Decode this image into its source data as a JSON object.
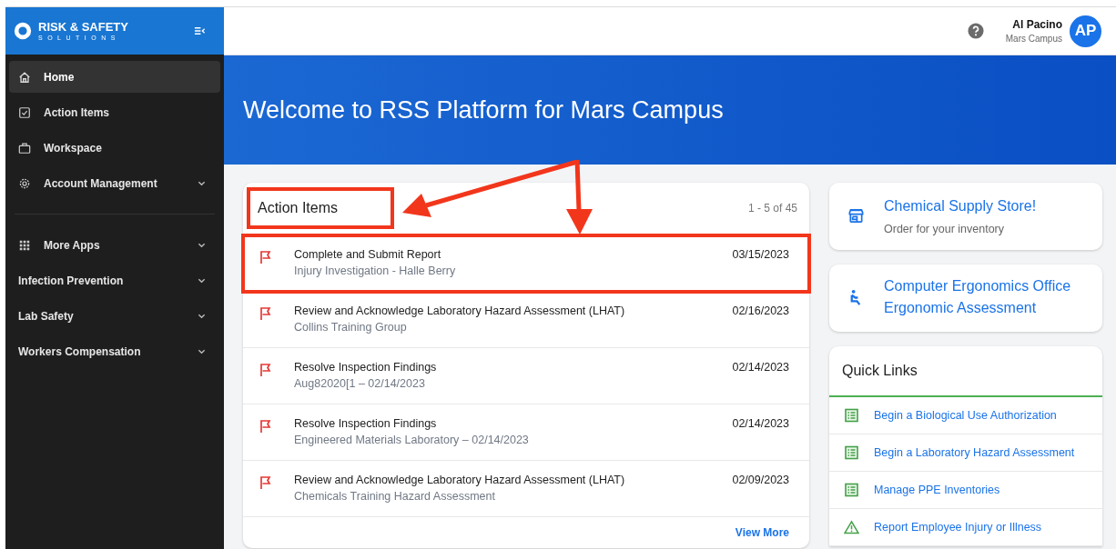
{
  "sidebar": {
    "logo": {
      "line1": "RISK & SAFETY",
      "line2": "SOLUTIONS"
    },
    "items": [
      {
        "label": "Home",
        "kind": "home",
        "selected": true,
        "expandable": false
      },
      {
        "label": "Action Items",
        "kind": "tasks",
        "selected": false,
        "expandable": false
      },
      {
        "label": "Workspace",
        "kind": "workspace",
        "selected": false,
        "expandable": false
      },
      {
        "label": "Account Management",
        "kind": "settings",
        "selected": false,
        "expandable": true
      }
    ],
    "apps": [
      {
        "label": "More Apps",
        "kind": "apps",
        "selected": false,
        "expandable": true
      },
      {
        "label": "Infection Prevention",
        "kind": "module",
        "selected": false,
        "expandable": true
      },
      {
        "label": "Lab Safety",
        "kind": "module",
        "selected": false,
        "expandable": true
      },
      {
        "label": "Workers Compensation",
        "kind": "module",
        "selected": false,
        "expandable": true
      }
    ]
  },
  "header": {
    "user_name": "Al Pacino",
    "user_campus": "Mars Campus",
    "avatar": "AP"
  },
  "banner": {
    "title": "Welcome to RSS Platform for Mars Campus"
  },
  "action_items": {
    "title": "Action Items",
    "title_highlighted": true,
    "count": "1 - 5 of 45",
    "view_more": "View More",
    "rows": [
      {
        "title": "Complete and Submit Report",
        "subtitle": "Injury Investigation - Halle Berry",
        "date": "03/15/2023",
        "highlighted": true
      },
      {
        "title": "Review and Acknowledge Laboratory Hazard Assessment (LHAT)",
        "subtitle": "Collins Training Group",
        "date": "02/16/2023",
        "highlighted": false
      },
      {
        "title": "Resolve Inspection Findings",
        "subtitle": "Aug82020[1 – 02/14/2023",
        "date": "02/14/2023",
        "highlighted": false
      },
      {
        "title": "Resolve Inspection Findings",
        "subtitle": "Engineered Materials Laboratory – 02/14/2023",
        "date": "02/14/2023",
        "highlighted": false
      },
      {
        "title": "Review and Acknowledge Laboratory Hazard Assessment (LHAT)",
        "subtitle": "Chemicals Training Hazard Assessment",
        "date": "02/09/2023",
        "highlighted": false
      }
    ]
  },
  "promo_cards": [
    {
      "kind": "store",
      "title": "Chemical Supply Store!",
      "subtitle": "Order for your inventory"
    },
    {
      "kind": "ergonomics",
      "title": "Computer Ergonomics Office Ergonomic Assessment"
    }
  ],
  "quick_links": {
    "title": "Quick Links",
    "links": [
      {
        "kind": "form",
        "label": "Begin a Biological Use Authorization"
      },
      {
        "kind": "form",
        "label": "Begin a Laboratory Hazard Assessment"
      },
      {
        "kind": "form",
        "label": "Manage PPE Inventories"
      },
      {
        "kind": "hazard",
        "label": "Report Employee Injury or Illness"
      }
    ]
  }
}
